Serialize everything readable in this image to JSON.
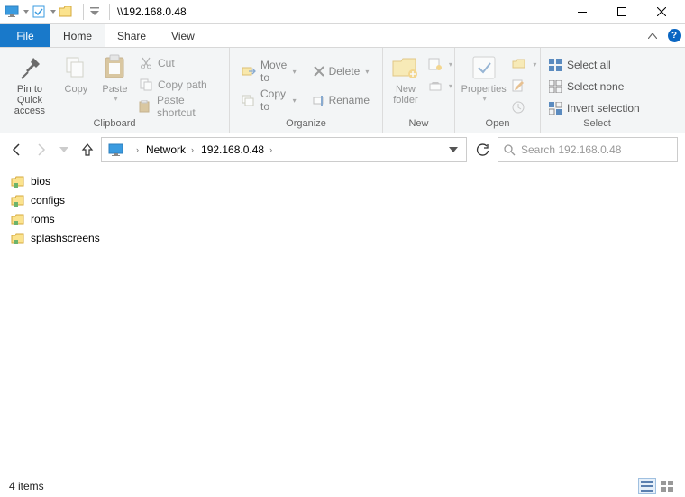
{
  "window": {
    "title": "\\\\192.168.0.48"
  },
  "tabs": {
    "file": "File",
    "home": "Home",
    "share": "Share",
    "view": "View"
  },
  "ribbon": {
    "clipboard": {
      "group_label": "Clipboard",
      "pin": "Pin to Quick\naccess",
      "copy": "Copy",
      "paste": "Paste",
      "cut": "Cut",
      "copypath": "Copy path",
      "pasteshortcut": "Paste shortcut"
    },
    "organize": {
      "group_label": "Organize",
      "moveto": "Move to",
      "copyto": "Copy to",
      "delete": "Delete",
      "rename": "Rename"
    },
    "new": {
      "group_label": "New",
      "newfolder": "New\nfolder"
    },
    "open": {
      "group_label": "Open",
      "properties": "Properties"
    },
    "select": {
      "group_label": "Select",
      "selectall": "Select all",
      "selectnone": "Select none",
      "invertselection": "Invert selection"
    }
  },
  "breadcrumb": {
    "root": "Network",
    "host": "192.168.0.48"
  },
  "search": {
    "placeholder": "Search 192.168.0.48"
  },
  "folders": [
    "bios",
    "configs",
    "roms",
    "splashscreens"
  ],
  "status": {
    "count": "4 items"
  }
}
